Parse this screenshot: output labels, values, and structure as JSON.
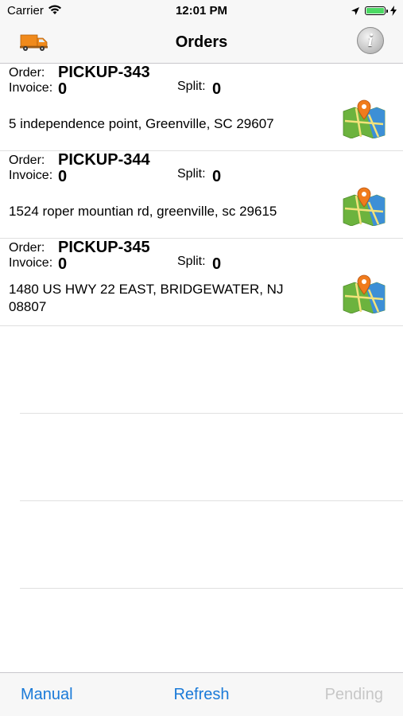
{
  "status_bar": {
    "carrier": "Carrier",
    "time": "12:01 PM"
  },
  "nav": {
    "title": "Orders",
    "left_icon": "truck-icon",
    "right_icon": "info-icon"
  },
  "labels": {
    "order": "Order:",
    "invoice": "Invoice:",
    "split": "Split:"
  },
  "orders": [
    {
      "order": "PICKUP-343",
      "invoice": "0",
      "split": "0",
      "address": "5 independence point, Greenville, SC 29607"
    },
    {
      "order": "PICKUP-344",
      "invoice": "0",
      "split": "0",
      "address": "1524 roper mountian rd, greenville, sc 29615"
    },
    {
      "order": "PICKUP-345",
      "invoice": "0",
      "split": "0",
      "address": "1480 US HWY 22 EAST, BRIDGEWATER, NJ 08807"
    }
  ],
  "toolbar": {
    "manual": "Manual",
    "refresh": "Refresh",
    "pending": "Pending"
  },
  "colors": {
    "accent": "#1a7ad8",
    "disabled": "#c7c7c7",
    "truck": "#f08a1c"
  }
}
